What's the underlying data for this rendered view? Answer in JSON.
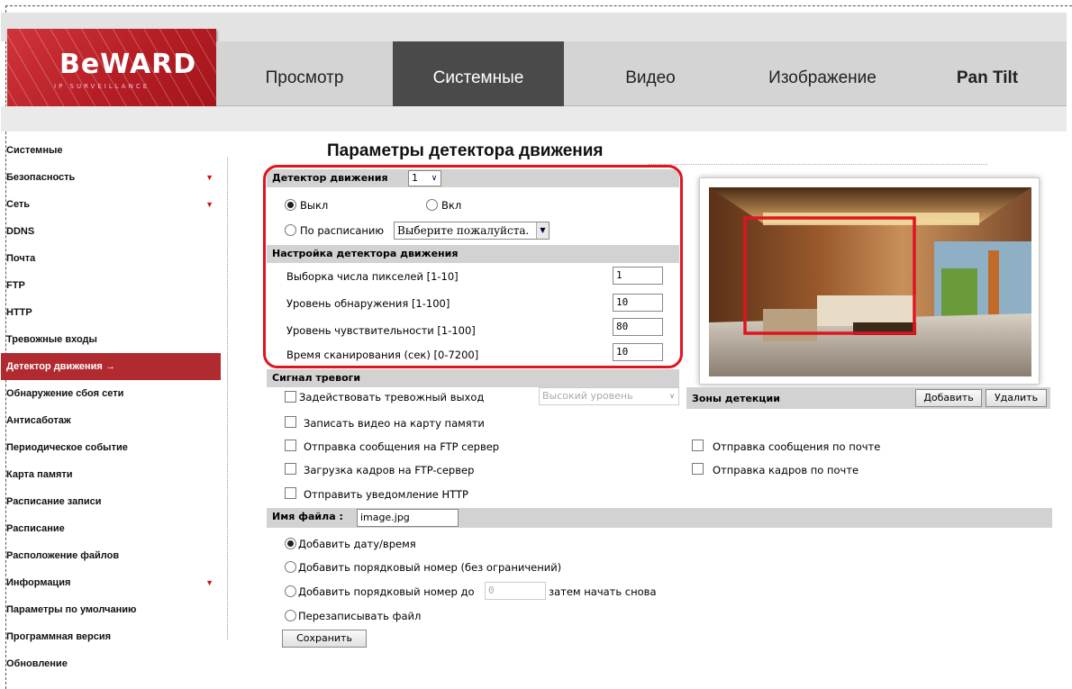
{
  "header": {
    "brand": "BeWARD",
    "tagline": "IP SURVEILLANCE",
    "tabs": [
      {
        "label": "Просмотр"
      },
      {
        "label": "Системные"
      },
      {
        "label": "Видео"
      },
      {
        "label": "Изображение"
      },
      {
        "label": "Pan Tilt"
      }
    ]
  },
  "sidebar": {
    "items": [
      {
        "label": "Системные"
      },
      {
        "label": "Безопасность",
        "arrow": "▼"
      },
      {
        "label": "Сеть",
        "arrow": "▼"
      },
      {
        "label": "DDNS"
      },
      {
        "label": "Почта"
      },
      {
        "label": "FTP"
      },
      {
        "label": "HTTP"
      },
      {
        "label": "Тревожные входы"
      },
      {
        "label": "Детектор движения →"
      },
      {
        "label": "Обнаружение сбоя сети"
      },
      {
        "label": "Антисаботаж"
      },
      {
        "label": "Периодическое событие"
      },
      {
        "label": "Карта памяти"
      },
      {
        "label": "Расписание записи"
      },
      {
        "label": "Расписание"
      },
      {
        "label": "Расположение файлов"
      },
      {
        "label": "Информация",
        "arrow": "▼"
      },
      {
        "label": "Параметры по умолчанию"
      },
      {
        "label": "Программная версия"
      },
      {
        "label": "Обновление"
      }
    ]
  },
  "main": {
    "title": "Параметры детектора движения",
    "detector": {
      "label": "Детектор движения",
      "select_value": "1",
      "off_label": "Выкл",
      "on_label": "Вкл",
      "schedule_label": "По расписанию",
      "schedule_select": "Выберите пожалуйста.",
      "state": "off"
    },
    "settings": {
      "header": "Настройка детектора движения",
      "rows": [
        {
          "label": "Выборка числа пикселей [1-10]",
          "value": "1"
        },
        {
          "label": "Уровень обнаружения [1-100]",
          "value": "10"
        },
        {
          "label": "Уровень чувствительности [1-100]",
          "value": "80"
        },
        {
          "label": "Время сканирования (сек) [0-7200]",
          "value": "10"
        }
      ]
    },
    "alarm": {
      "header": "Сигнал тревоги",
      "output_label": "Задействовать тревожный выход",
      "output_level": "Высокий уровень",
      "sd_label": "Записать видео на карту памяти",
      "ftp_msg_label": "Отправка сообщения на FTP сервер",
      "ftp_frames_label": "Загрузка кадров на FTP-сервер",
      "http_label": "Отправить уведомление HTTP",
      "mail_msg_label": "Отправка сообщения по почте",
      "mail_frames_label": "Отправка кадров по почте"
    },
    "zones": {
      "label": "Зоны детекции",
      "add_label": "Добавить",
      "delete_label": "Удалить"
    },
    "filename": {
      "label": "Имя файла :",
      "value": "image.jpg",
      "opt_datetime": "Добавить дату/время",
      "opt_seq_unlimited": "Добавить порядковый номер (без ограничений)",
      "opt_seq_upto": "Добавить порядковый номер до",
      "seq_upto_value": "0",
      "opt_seq_upto_suffix": "затем начать снова",
      "opt_overwrite": "Перезаписывать файл",
      "selected": "datetime"
    },
    "save_label": "Сохранить"
  },
  "colors": {
    "brand_red": "#b51d24",
    "highlight_red": "#e0141f",
    "nav_active": "#4a4a4a"
  }
}
